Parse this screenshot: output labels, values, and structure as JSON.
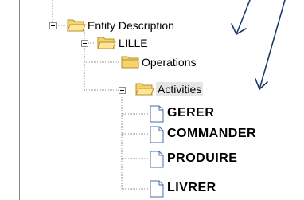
{
  "tree": {
    "root": {
      "label": "Entity Description",
      "icon": "folder-open-icon",
      "expanded": true
    },
    "lille": {
      "label": "LILLE",
      "icon": "folder-open-icon",
      "expanded": true
    },
    "operations": {
      "label": "Operations",
      "icon": "folder-icon"
    },
    "activities": {
      "label": "Activities",
      "icon": "folder-open-icon",
      "expanded": true
    },
    "items": [
      {
        "label": "GERER",
        "icon": "document-icon"
      },
      {
        "label": "COMMANDER",
        "icon": "document-icon"
      },
      {
        "label": "PRODUIRE",
        "icon": "document-icon"
      },
      {
        "label": "LIVRER",
        "icon": "document-icon"
      }
    ]
  },
  "colors": {
    "folder": "#f4d46a",
    "folder_stroke": "#b8902a",
    "arrow": "#1f3a68"
  }
}
